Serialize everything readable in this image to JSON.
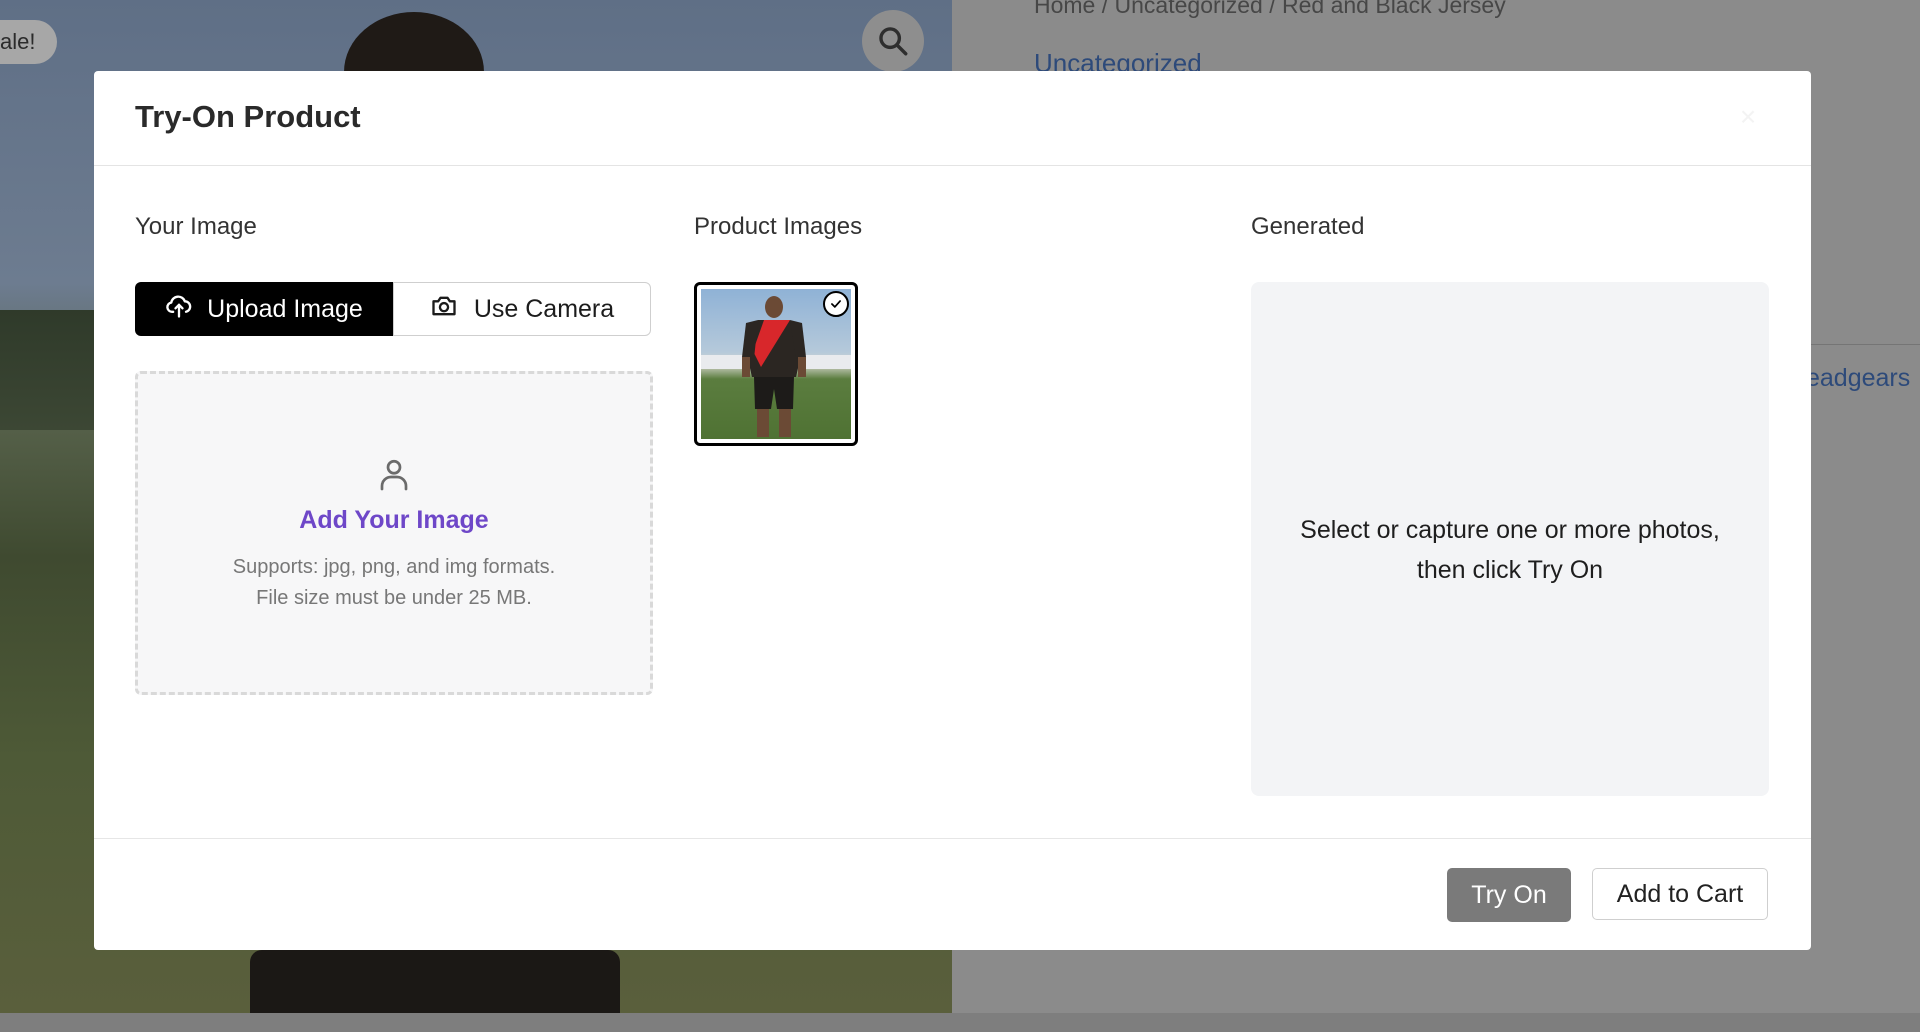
{
  "background": {
    "sale_badge": "ale!",
    "breadcrumb": "Home / Uncategorized / Red and Black Jersey",
    "category_link": "Uncategorized",
    "side_link": "eadgears"
  },
  "modal": {
    "title": "Try-On Product",
    "close_label": "×",
    "your_image": {
      "label": "Your Image",
      "upload_button": "Upload Image",
      "camera_button": "Use Camera",
      "dropzone_title": "Add Your Image",
      "dropzone_help_line1": "Supports: jpg, png, and img formats.",
      "dropzone_help_line2": "File size must be under 25 MB."
    },
    "product_images": {
      "label": "Product Images",
      "items": [
        {
          "icon": "jersey-model-photo",
          "selected": true
        }
      ]
    },
    "generated": {
      "label": "Generated",
      "message_line1": "Select or capture one or more photos,",
      "message_line2": "then click Try On"
    },
    "footer": {
      "try_on_button": "Try On",
      "add_to_cart_button": "Add to Cart"
    }
  },
  "colors": {
    "accent_purple": "#6e47c8",
    "primary_black": "#000000",
    "disabled_gray": "#7a7a7a"
  }
}
